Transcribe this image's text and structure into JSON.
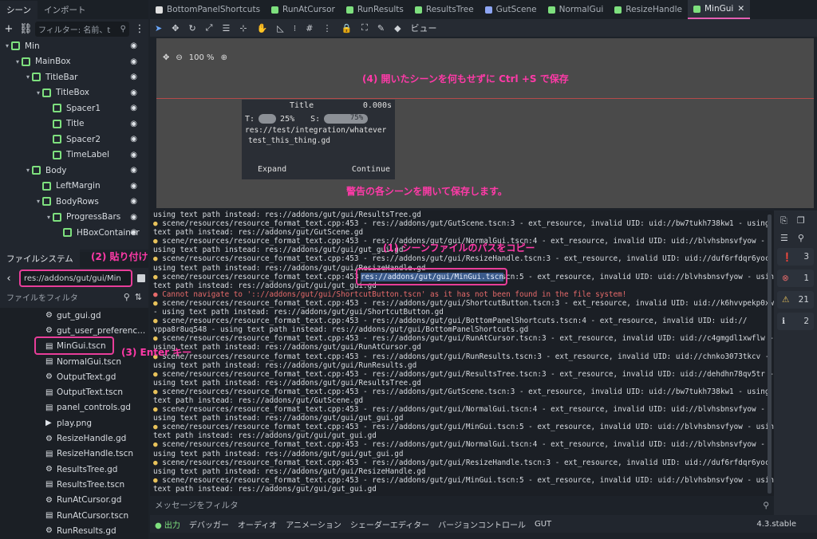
{
  "scene_dock": {
    "tab_scene": "シーン",
    "tab_import": "インポート",
    "filter_placeholder": "フィルター: 名前、t",
    "tree": [
      {
        "label": "Min",
        "level": 0,
        "color": "#7ee07e"
      },
      {
        "label": "MainBox",
        "level": 1,
        "color": "#7ee07e"
      },
      {
        "label": "TitleBar",
        "level": 2,
        "color": "#7ee07e"
      },
      {
        "label": "TitleBox",
        "level": 3,
        "color": "#7ee07e"
      },
      {
        "label": "Spacer1",
        "level": 4,
        "color": "#7ee07e"
      },
      {
        "label": "Title",
        "level": 4,
        "color": "#7ee07e"
      },
      {
        "label": "Spacer2",
        "level": 4,
        "color": "#7ee07e"
      },
      {
        "label": "TimeLabel",
        "level": 4,
        "color": "#7ee07e"
      },
      {
        "label": "Body",
        "level": 2,
        "color": "#7ee07e"
      },
      {
        "label": "LeftMargin",
        "level": 3,
        "color": "#7ee07e"
      },
      {
        "label": "BodyRows",
        "level": 3,
        "color": "#7ee07e"
      },
      {
        "label": "ProgressBars",
        "level": 4,
        "color": "#7ee07e"
      },
      {
        "label": "HBoxContainer",
        "level": 5,
        "color": "#7ee07e"
      }
    ]
  },
  "file_dock": {
    "title": "ファイルシステム",
    "path": "res://addons/gut/gui/Min",
    "filter": "ファイルをフィルタ",
    "files": [
      {
        "icon": "gear",
        "name": "gut_gui.gd"
      },
      {
        "icon": "gear",
        "name": "gut_user_preferenc..."
      },
      {
        "icon": "clap",
        "name": "MinGui.tscn"
      },
      {
        "icon": "clap",
        "name": "NormalGui.tscn"
      },
      {
        "icon": "gear",
        "name": "OutputText.gd"
      },
      {
        "icon": "clap",
        "name": "OutputText.tscn"
      },
      {
        "icon": "clap",
        "name": "panel_controls.gd"
      },
      {
        "icon": "play",
        "name": "play.png"
      },
      {
        "icon": "gear",
        "name": "ResizeHandle.gd"
      },
      {
        "icon": "clap",
        "name": "ResizeHandle.tscn"
      },
      {
        "icon": "gear",
        "name": "ResultsTree.gd"
      },
      {
        "icon": "clap",
        "name": "ResultsTree.tscn"
      },
      {
        "icon": "gear",
        "name": "RunAtCursor.gd"
      },
      {
        "icon": "clap",
        "name": "RunAtCursor.tscn"
      },
      {
        "icon": "gear",
        "name": "RunResults.gd"
      }
    ]
  },
  "editor_tabs": [
    {
      "label": "BottomPanelShortcuts",
      "color": "#e0e0e0"
    },
    {
      "label": "RunAtCursor",
      "color": "#7ee07e"
    },
    {
      "label": "RunResults",
      "color": "#7ee07e"
    },
    {
      "label": "ResultsTree",
      "color": "#7ee07e"
    },
    {
      "label": "GutScene",
      "color": "#8da5f3"
    },
    {
      "label": "NormalGui",
      "color": "#7ee07e"
    },
    {
      "label": "ResizeHandle",
      "color": "#7ee07e"
    },
    {
      "label": "MinGui",
      "color": "#7ee07e"
    }
  ],
  "toolbar": {
    "view_label": "ビュー"
  },
  "viewport": {
    "zoom": "100 %",
    "gui": {
      "title": "Title",
      "time": "0.000s",
      "t_label": "T:",
      "t_pct": "25%",
      "s_label": "S:",
      "s_pct": "75%",
      "path": "res://test/integration/whatever",
      "test": "test_this_thing.gd",
      "expand": "Expand",
      "continue": "Continue"
    }
  },
  "annotations": {
    "a1": "(1) シーンファイルのパスをコピー",
    "a2": "(2) 貼り付け",
    "a3": "(3) Enter キー",
    "a4": "(4) 開いたシーンを何もせずに Ctrl +S で保存",
    "a5": "警告の各シーンを開いて保存します。"
  },
  "output": {
    "lines": [
      {
        "k": "w",
        "t": "using text path instead: res://addons/gut/gui/ResultsTree.gd"
      },
      {
        "k": "w",
        "t": "● scene/resources/resource_format_text.cpp:453 - res://addons/gut/GutScene.tscn:3 - ext_resource, invalid UID: uid://bw7tukh738kw1 - using"
      },
      {
        "k": "w",
        "t": "text path instead: res://addons/gut/GutScene.gd"
      },
      {
        "k": "w",
        "t": "● scene/resources/resource_format_text.cpp:453 - res://addons/gut/gui/NormalGui.tscn:4 - ext_resource, invalid UID: uid://blvhsbnsvfyow -"
      },
      {
        "k": "w",
        "t": "using text path instead: res://addons/gut/gui/gut_gui.gd"
      },
      {
        "k": "w",
        "t": "● scene/resources/resource_format_text.cpp:453 - res://addons/gut/gui/ResizeHandle.tscn:3 - ext_resource, invalid UID: uid://duf6rfdqr6yoc -"
      },
      {
        "k": "w",
        "t": "using text path instead: res://addons/gut/gui/ResizeHandle.gd"
      },
      {
        "k": "w",
        "t": "● scene/resources/resource_format_text.cpp:453 - res://addons/gut/gui/MinGui.tscn:5 - ext_resource, invalid UID: uid://blvhsbnsvfyow - using"
      },
      {
        "k": "w",
        "t": "text path instead: res://addons/gut/gui/gut_gui.gd"
      },
      {
        "k": "e",
        "t": "● Cannot navigate to ':://addons/gut/gui/ShortcutButton.tscn' as it has not been found in the file system!"
      },
      {
        "k": "w",
        "t": "● scene/resources/resource_format_text.cpp:453 - res://addons/gut/gui/ShortcutButton.tscn:3 - ext_resource, invalid UID: uid://k6hvvpekp0xw"
      },
      {
        "k": "w",
        "t": "- using text path instead: res://addons/gut/gui/ShortcutButton.gd"
      },
      {
        "k": "w",
        "t": "● scene/resources/resource_format_text.cpp:453 - res://addons/gut/gui/BottomPanelShortcuts.tscn:4 - ext_resource, invalid UID: uid://"
      },
      {
        "k": "w",
        "t": "vppa8r8uq548 - using text path instead: res://addons/gut/gui/BottomPanelShortcuts.gd"
      },
      {
        "k": "w",
        "t": "● scene/resources/resource_format_text.cpp:453 - res://addons/gut/gui/RunAtCursor.tscn:3 - ext_resource, invalid UID: uid://c4gmgdl1xwflw -"
      },
      {
        "k": "w",
        "t": "using text path instead: res://addons/gut/gui/RunAtCursor.gd"
      },
      {
        "k": "w",
        "t": "● scene/resources/resource_format_text.cpp:453 - res://addons/gut/gui/RunResults.tscn:3 - ext_resource, invalid UID: uid://chnko3073tkcv -"
      },
      {
        "k": "w",
        "t": "using text path instead: res://addons/gut/gui/RunResults.gd"
      },
      {
        "k": "w",
        "t": "● scene/resources/resource_format_text.cpp:453 - res://addons/gut/gui/ResultsTree.tscn:3 - ext_resource, invalid UID: uid://dehdhn78qv5tr -"
      },
      {
        "k": "w",
        "t": "using text path instead: res://addons/gut/gui/ResultsTree.gd"
      },
      {
        "k": "w",
        "t": "● scene/resources/resource_format_text.cpp:453 - res://addons/gut/GutScene.tscn:3 - ext_resource, invalid UID: uid://bw7tukh738kw1 - using"
      },
      {
        "k": "w",
        "t": "text path instead: res://addons/gut/GutScene.gd"
      },
      {
        "k": "w",
        "t": "● scene/resources/resource_format_text.cpp:453 - res://addons/gut/gui/NormalGui.tscn:4 - ext_resource, invalid UID: uid://blvhsbnsvfyow -"
      },
      {
        "k": "w",
        "t": "using text path instead: res://addons/gut/gui/gut_gui.gd"
      },
      {
        "k": "w",
        "t": "● scene/resources/resource_format_text.cpp:453 - res://addons/gut/gui/MinGui.tscn:5 - ext_resource, invalid UID: uid://blvhsbnsvfyow - using"
      },
      {
        "k": "w",
        "t": "text path instead: res://addons/gut/gui/gut_gui.gd"
      },
      {
        "k": "w",
        "t": "● scene/resources/resource_format_text.cpp:453 - res://addons/gut/gui/NormalGui.tscn:4 - ext_resource, invalid UID: uid://blvhsbnsvfyow -"
      },
      {
        "k": "w",
        "t": "using text path instead: res://addons/gut/gui/gut_gui.gd"
      },
      {
        "k": "w",
        "t": "● scene/resources/resource_format_text.cpp:453 - res://addons/gut/gui/ResizeHandle.tscn:3 - ext_resource, invalid UID: uid://duf6rfdqr6yoc -"
      },
      {
        "k": "w",
        "t": "using text path instead: res://addons/gut/gui/ResizeHandle.gd"
      },
      {
        "k": "w",
        "t": "● scene/resources/resource_format_text.cpp:453 - res://addons/gut/gui/MinGui.tscn:5 - ext_resource, invalid UID: uid://blvhsbnsvfyow - using"
      },
      {
        "k": "w",
        "t": "text path instead: res://addons/gut/gui/gut_gui.gd"
      }
    ],
    "highlight": "res://addons/gut/gui/MinGui.tscn",
    "counts": {
      "errors": "3",
      "warn_red": "1",
      "warnings": "21",
      "info": "2"
    },
    "filter_placeholder": "メッセージをフィルタ"
  },
  "bottom_tabs": [
    "出力",
    "デバッガー",
    "オーディオ",
    "アニメーション",
    "シェーダーエディター",
    "バージョンコントロール",
    "GUT"
  ],
  "version": "4.3.stable"
}
